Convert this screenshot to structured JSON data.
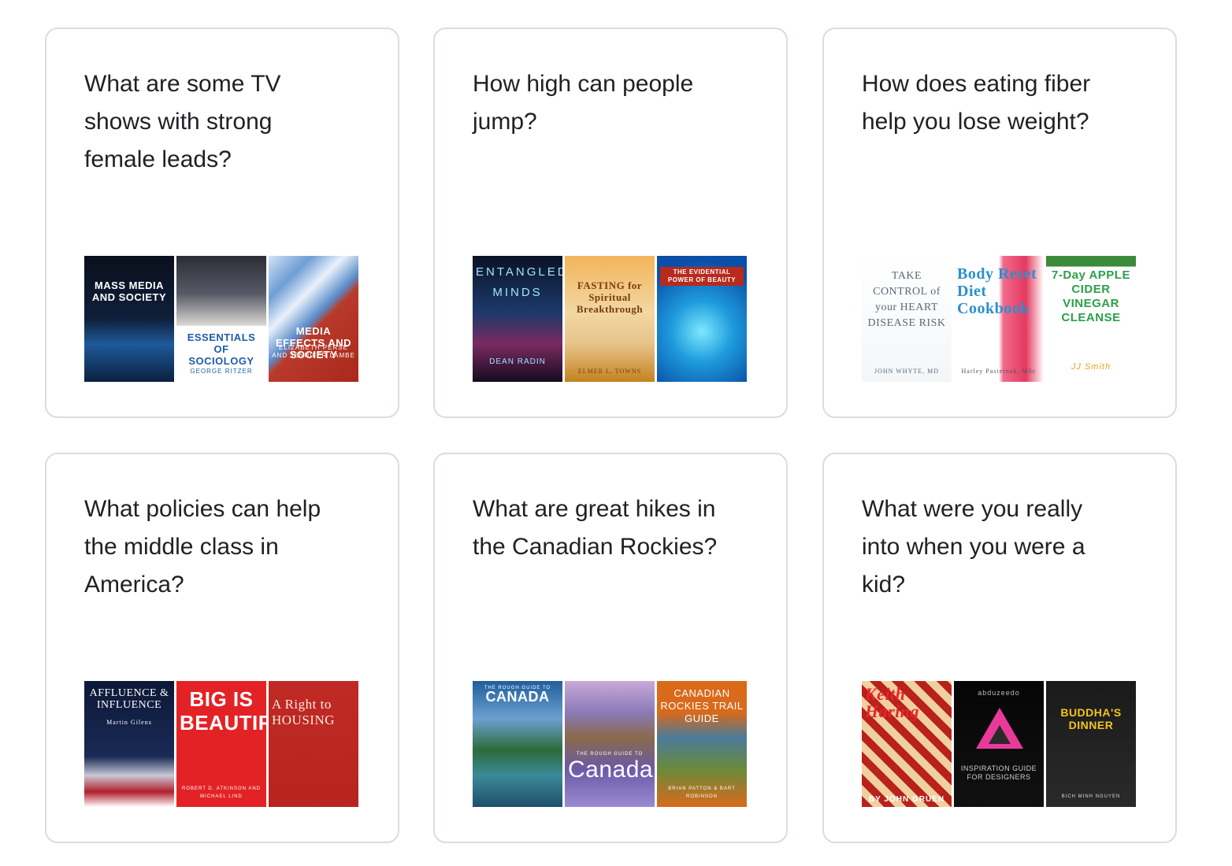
{
  "cards": [
    {
      "question": "What are some TV shows with strong female leads?",
      "books": [
        {
          "title": "MASS MEDIA AND SOCIETY",
          "author": "",
          "bg": "linear-gradient(180deg,#0a0f1c 0%,#0f1f3a 50%,#1e5a9a 70%,#0b2040 100%)",
          "color": "#ffffff"
        },
        {
          "title": "ESSENTIALS OF SOCIOLOGY",
          "author": "GEORGE RITZER",
          "bg": "linear-gradient(180deg,#2b2c35 0%,#575a66 30%,#d9d7d2 55%,#ffffff 56%,#ffffff 100%)",
          "color": "#1e5ca8"
        },
        {
          "title": "MEDIA EFFECTS AND SOCIETY",
          "author": "ELIZABETH PERSE AND JENNIFER LAMBE",
          "bg": "linear-gradient(135deg,#cfe3f4 0%,#6f9ed4 20%,#e8f2fb 35%,#5a8ac8 50%,#b93a2a 56%,#a8281c 100%)",
          "color": "#ffffff"
        }
      ]
    },
    {
      "question": "How high can people jump?",
      "books": [
        {
          "title": "ENTANGLED MINDS",
          "author": "DEAN RADIN",
          "bg": "linear-gradient(180deg,#0a1226 0%,#1c3a6a 45%,#7a2a62 70%,#140a1f 100%)",
          "color": "#9fe4ff"
        },
        {
          "title": "FASTING for Spiritual Breakthrough",
          "author": "ELMER L. TOWNS",
          "bg": "linear-gradient(180deg,#f3b45a 0%,#f2d8a2 45%,#e7c48a 70%,#c4821f 100%)",
          "color": "#7a3a12"
        },
        {
          "title": "THE EVIDENTIAL POWER OF BEAUTY",
          "author": "",
          "bg": "radial-gradient(circle at 50% 60%,#7de8ff 0%,#1e9bdc 35%,#0a4fa8 80%)",
          "color": "#ffffff"
        }
      ]
    },
    {
      "question": "How does eating fiber help you lose weight?",
      "books": [
        {
          "title": "TAKE CONTROL of your HEART DISEASE RISK",
          "author": "JOHN WHYTE, MD",
          "bg": "linear-gradient(180deg,#ffffff 0%,#f4f6f8 100%)",
          "color": "#5a6a78"
        },
        {
          "title": "Body Reset Diet Cookbook",
          "author": "Harley Pasternak, MSc",
          "bg": "linear-gradient(90deg,#ffffff 0%,#ffffff 50%,#f06a8a 55%,#e43a60 80%,#ffffff 100%)",
          "color": "#2a8fd0"
        },
        {
          "title": "7-Day APPLE CIDER VINEGAR CLEANSE",
          "author": "JJ Smith",
          "bg": "linear-gradient(180deg,#3a8a3a 0%,#3a8a3a 8%,#ffffff 9%,#ffffff 100%)",
          "color": "#2aa04a"
        }
      ]
    },
    {
      "question": "What policies can help the middle class in America?",
      "books": [
        {
          "title": "AFFLUENCE & INFLUENCE",
          "author": "Martin Gilens",
          "bg": "linear-gradient(180deg,#0c1836 0%,#1a2a55 60%,#c8c8d6 75%,#b21f2a 88%,#ffffff 100%)",
          "color": "#ffffff"
        },
        {
          "title": "BIG IS BEAUTIFUL",
          "author": "ROBERT D. ATKINSON AND MICHAEL LIND",
          "bg": "linear-gradient(180deg,#e32226 0%,#e32226 100%)",
          "color": "#ffffff"
        },
        {
          "title": "A Right to HOUSING",
          "author": "",
          "bg": "linear-gradient(180deg,#c02a25 0%,#b7241f 100%)",
          "color": "#ffe8df"
        }
      ]
    },
    {
      "question": "What are great hikes in the Canadian Rockies?",
      "books": [
        {
          "title": "CANADA",
          "author": "THE ROUGH GUIDE TO",
          "bg": "linear-gradient(180deg,#1f5e9c 0%,#6da0d0 30%,#2d6a3a 55%,#3a8a9a 75%,#1f4f6a 100%)",
          "color": "#ffffff"
        },
        {
          "title": "Canada",
          "author": "THE ROUGH GUIDE TO",
          "bg": "linear-gradient(180deg,#c9a9d8 0%,#8a7ab8 25%,#8a6a4a 45%,#6a5aa8 70%,#9a8ad0 100%)",
          "color": "#ffffff"
        },
        {
          "title": "CANADIAN ROCKIES TRAIL GUIDE",
          "author": "BRIAN PATTON & BART ROBINSON",
          "bg": "linear-gradient(180deg,#d86a1a 0%,#d86a1a 25%,#4a7a9a 45%,#6a8a3a 70%,#d86a1a 100%)",
          "color": "#ffffff"
        }
      ]
    },
    {
      "question": "What were you really into when you were a kid?",
      "books": [
        {
          "title": "Keith Haring",
          "author": "BY JOHN GRUEN",
          "bg": "repeating-linear-gradient(45deg,#b8221a 0px,#b8221a 10px,#f0d0a0 10px,#f0d0a0 20px)",
          "color": "#e8242a"
        },
        {
          "title": "INSPIRATION GUIDE FOR DESIGNERS",
          "author": "abduzeedo",
          "bg": "linear-gradient(180deg,#050505 0%,#111111 100%)",
          "color": "#cfcfcf"
        },
        {
          "title": "BUDDHA'S DINNER",
          "author": "BICH MINH NGUYEN",
          "bg": "linear-gradient(180deg,#1a1a1a 0%,#2a2a2a 100%)",
          "color": "#f5c518"
        }
      ]
    }
  ]
}
